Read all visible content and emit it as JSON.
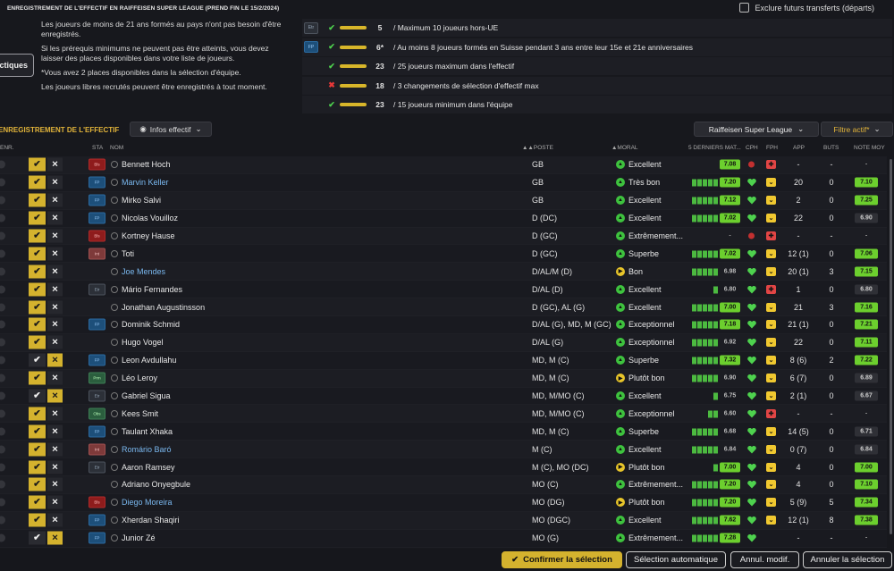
{
  "header": {
    "title": "ENREGISTREMENT DE L'EFFECTIF EN RAIFFEISEN SUPER LEAGUE (PREND FIN LE 15/2/2024)",
    "exclude_label": "Exclure futurs transferts (départs)"
  },
  "info": {
    "p1": "Les joueurs de moins de 21 ans formés au pays n'ont pas besoin d'être enregistrés.",
    "p2": "Si les prérequis minimums ne peuvent pas être atteints, vous devez laisser des places disponibles dans votre liste de joueurs.",
    "p3": "*Vous avez 2 places disponibles dans la sélection d'équipe.",
    "p4": "Les joueurs libres recrutés peuvent être enregistrés à tout moment.",
    "tactiques": "ctiques"
  },
  "rules": [
    {
      "tag": "Etr",
      "status": "ok",
      "count": "5",
      "text": "/ Maximum 10 joueurs hors-UE"
    },
    {
      "tag": "FP",
      "status": "ok",
      "count": "6*",
      "text": "/ Au moins 8 joueurs formés en Suisse pendant 3 ans entre leur 15e et 21e anniversaires"
    },
    {
      "tag": "",
      "status": "ok",
      "count": "23",
      "text": "/ 25 joueurs maximum dans l'effectif"
    },
    {
      "tag": "",
      "status": "ko",
      "count": "18",
      "text": "/ 3 changements de sélection d'effectif max"
    },
    {
      "tag": "",
      "status": "ok",
      "count": "23",
      "text": "/ 15 joueurs minimum dans l'équipe"
    }
  ],
  "section": {
    "title": "ENREGISTREMENT DE L'EFFECTIF",
    "infos_button": "Infos effectif",
    "league_button": "Raiffeisen Super League",
    "filter_button": "Filtre actif*"
  },
  "columns": {
    "enr": "ENR.",
    "sta": "STA",
    "nom": "NOM",
    "poste": "▲▲POSTE",
    "moral": "▲MORAL",
    "matches": "5 DERNIERS MAT...",
    "cph": "CPH",
    "fph": "FPH",
    "app": "APP",
    "buts": "BUTS",
    "note": "NOTE MOY"
  },
  "players": [
    {
      "sel": "y",
      "x": "d",
      "sta": "Bls",
      "name": "Bennett Hoch",
      "blue": false,
      "pos": "GB",
      "moral_icon": "g",
      "moral": "Excellent",
      "bars": 0,
      "rating": "7.08",
      "rtype": "green",
      "cph": "red",
      "fph": "r",
      "app": "-",
      "buts": "-",
      "note": "-",
      "ntype": "dash"
    },
    {
      "sel": "y",
      "x": "d",
      "sta": "FP",
      "name": "Marvin Keller",
      "blue": true,
      "pos": "GB",
      "moral_icon": "g",
      "moral": "Très bon",
      "bars": 5,
      "rating": "7.20",
      "rtype": "green",
      "cph": "heart",
      "fph": "y",
      "app": "20",
      "buts": "0",
      "note": "7.10",
      "ntype": "green"
    },
    {
      "sel": "y",
      "x": "d",
      "sta": "FP",
      "name": "Mirko Salvi",
      "blue": false,
      "pos": "GB",
      "moral_icon": "g",
      "moral": "Excellent",
      "bars": 5,
      "rating": "7.12",
      "rtype": "green",
      "cph": "heart",
      "fph": "y",
      "app": "2",
      "buts": "0",
      "note": "7.25",
      "ntype": "green"
    },
    {
      "sel": "y",
      "x": "d",
      "sta": "FP",
      "name": "Nicolas Vouilloz",
      "blue": false,
      "pos": "D (DC)",
      "moral_icon": "g",
      "moral": "Excellent",
      "bars": 5,
      "rating": "7.02",
      "rtype": "green",
      "cph": "heart",
      "fph": "y",
      "app": "22",
      "buts": "0",
      "note": "6.90",
      "ntype": "grey"
    },
    {
      "sel": "y",
      "x": "d",
      "sta": "Bls",
      "name": "Kortney Hause",
      "blue": false,
      "pos": "D (GC)",
      "moral_icon": "g",
      "moral": "Extrêmement...",
      "bars": 0,
      "rating": "-",
      "rtype": "dash",
      "cph": "red",
      "fph": "r",
      "app": "-",
      "buts": "-",
      "note": "-",
      "ntype": "dash"
    },
    {
      "sel": "y",
      "x": "d",
      "sta": "Int",
      "name": "Toti",
      "blue": false,
      "pos": "D (GC)",
      "moral_icon": "g",
      "moral": "Superbe",
      "bars": 5,
      "rating": "7.02",
      "rtype": "green",
      "cph": "heart",
      "fph": "y",
      "app": "12 (1)",
      "buts": "0",
      "note": "7.06",
      "ntype": "green"
    },
    {
      "sel": "y",
      "x": "d",
      "sta": "",
      "name": "Joe Mendes",
      "blue": true,
      "pos": "D/AL/M (D)",
      "moral_icon": "y",
      "moral": "Bon",
      "bars": 5,
      "rating": "6.98",
      "rtype": "grey",
      "cph": "heart",
      "fph": "y",
      "app": "20 (1)",
      "buts": "3",
      "note": "7.15",
      "ntype": "green"
    },
    {
      "sel": "y",
      "x": "d",
      "sta": "Etr",
      "name": "Mário Fernandes",
      "blue": false,
      "pos": "D/AL (D)",
      "moral_icon": "g",
      "moral": "Excellent",
      "bars": 1,
      "rating": "6.80",
      "rtype": "grey",
      "cph": "heart",
      "fph": "r",
      "app": "1",
      "buts": "0",
      "note": "6.80",
      "ntype": "grey"
    },
    {
      "sel": "y",
      "x": "d",
      "sta": "",
      "name": "Jonathan Augustinsson",
      "blue": false,
      "pos": "D (GC), AL (G)",
      "moral_icon": "g",
      "moral": "Excellent",
      "bars": 5,
      "rating": "7.00",
      "rtype": "green",
      "cph": "heart",
      "fph": "y",
      "app": "21",
      "buts": "3",
      "note": "7.16",
      "ntype": "green"
    },
    {
      "sel": "y",
      "x": "d",
      "sta": "FP",
      "name": "Dominik Schmid",
      "blue": false,
      "pos": "D/AL (G), MD, M (GC)",
      "moral_icon": "g",
      "moral": "Exceptionnel",
      "bars": 5,
      "rating": "7.18",
      "rtype": "green",
      "cph": "heart",
      "fph": "y",
      "app": "21 (1)",
      "buts": "0",
      "note": "7.21",
      "ntype": "green"
    },
    {
      "sel": "y",
      "x": "d",
      "sta": "",
      "name": "Hugo Vogel",
      "blue": false,
      "pos": "D/AL (G)",
      "moral_icon": "g",
      "moral": "Exceptionnel",
      "bars": 5,
      "rating": "6.92",
      "rtype": "grey",
      "cph": "heart",
      "fph": "y",
      "app": "22",
      "buts": "0",
      "note": "7.11",
      "ntype": "green"
    },
    {
      "sel": "d",
      "x": "y",
      "sta": "FP",
      "name": "Leon Avdullahu",
      "blue": false,
      "pos": "MD, M (C)",
      "moral_icon": "g",
      "moral": "Superbe",
      "bars": 5,
      "rating": "7.32",
      "rtype": "green",
      "cph": "heart",
      "fph": "y",
      "app": "8 (6)",
      "buts": "2",
      "note": "7.22",
      "ntype": "green"
    },
    {
      "sel": "y",
      "x": "d",
      "sta": "Prm",
      "name": "Léo Leroy",
      "blue": false,
      "pos": "MD, M (C)",
      "moral_icon": "y",
      "moral": "Plutôt bon",
      "bars": 5,
      "rating": "6.90",
      "rtype": "grey",
      "cph": "heart",
      "fph": "y",
      "app": "6 (7)",
      "buts": "0",
      "note": "6.89",
      "ntype": "grey"
    },
    {
      "sel": "d",
      "x": "y",
      "sta": "Etr",
      "name": "Gabriel Sigua",
      "blue": false,
      "pos": "MD, M/MO (C)",
      "moral_icon": "g",
      "moral": "Excellent",
      "bars": 1,
      "rating": "6.75",
      "rtype": "grey",
      "cph": "heart",
      "fph": "y",
      "app": "2 (1)",
      "buts": "0",
      "note": "6.67",
      "ntype": "grey"
    },
    {
      "sel": "y",
      "x": "d",
      "sta": "Obs",
      "name": "Kees Smit",
      "blue": false,
      "pos": "MD, M/MO (C)",
      "moral_icon": "g",
      "moral": "Exceptionnel",
      "bars": 2,
      "rating": "6.60",
      "rtype": "grey",
      "cph": "heart",
      "fph": "r",
      "app": "-",
      "buts": "-",
      "note": "-",
      "ntype": "dash"
    },
    {
      "sel": "y",
      "x": "d",
      "sta": "FP",
      "name": "Taulant Xhaka",
      "blue": false,
      "pos": "MD, M (C)",
      "moral_icon": "g",
      "moral": "Superbe",
      "bars": 5,
      "rating": "6.68",
      "rtype": "grey",
      "cph": "heart",
      "fph": "y",
      "app": "14 (5)",
      "buts": "0",
      "note": "6.71",
      "ntype": "grey"
    },
    {
      "sel": "y",
      "x": "d",
      "sta": "Int",
      "name": "Romário Baró",
      "blue": true,
      "pos": "M (C)",
      "moral_icon": "g",
      "moral": "Excellent",
      "bars": 5,
      "rating": "6.84",
      "rtype": "grey",
      "cph": "heart",
      "fph": "y",
      "app": "0 (7)",
      "buts": "0",
      "note": "6.84",
      "ntype": "grey"
    },
    {
      "sel": "y",
      "x": "d",
      "sta": "Etr",
      "name": "Aaron Ramsey",
      "blue": false,
      "pos": "M (C), MO (DC)",
      "moral_icon": "y",
      "moral": "Plutôt bon",
      "bars": 1,
      "rating": "7.00",
      "rtype": "green",
      "cph": "heart",
      "fph": "y",
      "app": "4",
      "buts": "0",
      "note": "7.00",
      "ntype": "green"
    },
    {
      "sel": "y",
      "x": "d",
      "sta": "",
      "name": "Adriano Onyegbule",
      "blue": false,
      "pos": "MO (C)",
      "moral_icon": "g",
      "moral": "Extrêmement...",
      "bars": 5,
      "rating": "7.20",
      "rtype": "green",
      "cph": "heart",
      "fph": "y",
      "app": "4",
      "buts": "0",
      "note": "7.10",
      "ntype": "green"
    },
    {
      "sel": "y",
      "x": "d",
      "sta": "Bls",
      "name": "Diego Moreira",
      "blue": true,
      "pos": "MO (DG)",
      "moral_icon": "y",
      "moral": "Plutôt bon",
      "bars": 5,
      "rating": "7.20",
      "rtype": "green",
      "cph": "heart",
      "fph": "y",
      "app": "5 (9)",
      "buts": "5",
      "note": "7.34",
      "ntype": "green"
    },
    {
      "sel": "y",
      "x": "d",
      "sta": "FP",
      "name": "Xherdan Shaqiri",
      "blue": false,
      "pos": "MO (DGC)",
      "moral_icon": "g",
      "moral": "Excellent",
      "bars": 5,
      "rating": "7.62",
      "rtype": "green",
      "cph": "heart",
      "fph": "y",
      "app": "12 (1)",
      "buts": "8",
      "note": "7.38",
      "ntype": "green"
    },
    {
      "sel": "d",
      "x": "y",
      "sta": "FP",
      "name": "Junior Zé",
      "blue": false,
      "pos": "MO (G)",
      "moral_icon": "g",
      "moral": "Extrêmement...",
      "bars": 5,
      "rating": "7.28",
      "rtype": "green",
      "cph": "heart",
      "fph": "n",
      "app": "-",
      "buts": "-",
      "note": "-",
      "ntype": "dash"
    }
  ],
  "footer": {
    "confirm": "Confirmer la sélection",
    "auto": "Sélection automatique",
    "cancel_mod": "Annul. modif.",
    "cancel_sel": "Annuler la sélection"
  }
}
